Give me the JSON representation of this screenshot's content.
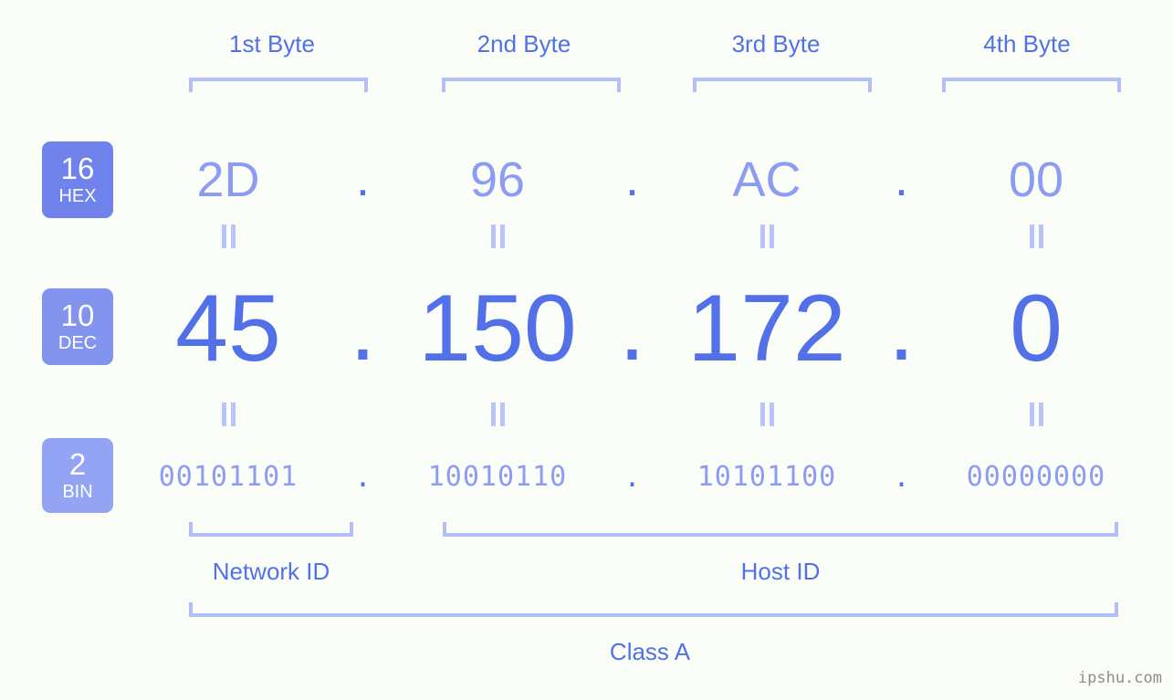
{
  "background_color": "#fbfdf8",
  "accent_strong": "#5271e8",
  "accent_light": "#8b9cf2",
  "bracket_color": "#b3bffa",
  "byte_headers": [
    {
      "label": "1st Byte"
    },
    {
      "label": "2nd Byte"
    },
    {
      "label": "3rd Byte"
    },
    {
      "label": "4th Byte"
    }
  ],
  "rows": {
    "hex": {
      "badge_number": "16",
      "badge_name": "HEX",
      "badge_color": "#7083ec",
      "values": [
        "2D",
        "96",
        "AC",
        "00"
      ],
      "separator": "."
    },
    "dec": {
      "badge_number": "10",
      "badge_name": "DEC",
      "badge_color": "#8394ef",
      "values": [
        "45",
        "150",
        "172",
        "0"
      ],
      "separator": "."
    },
    "bin": {
      "badge_number": "2",
      "badge_name": "BIN",
      "badge_color": "#93a4f4",
      "values": [
        "00101101",
        "10010110",
        "10101100",
        "00000000"
      ],
      "separator": "."
    }
  },
  "segments": {
    "network_id": "Network ID",
    "host_id": "Host ID",
    "class": "Class A"
  },
  "watermark": "ipshu.com"
}
